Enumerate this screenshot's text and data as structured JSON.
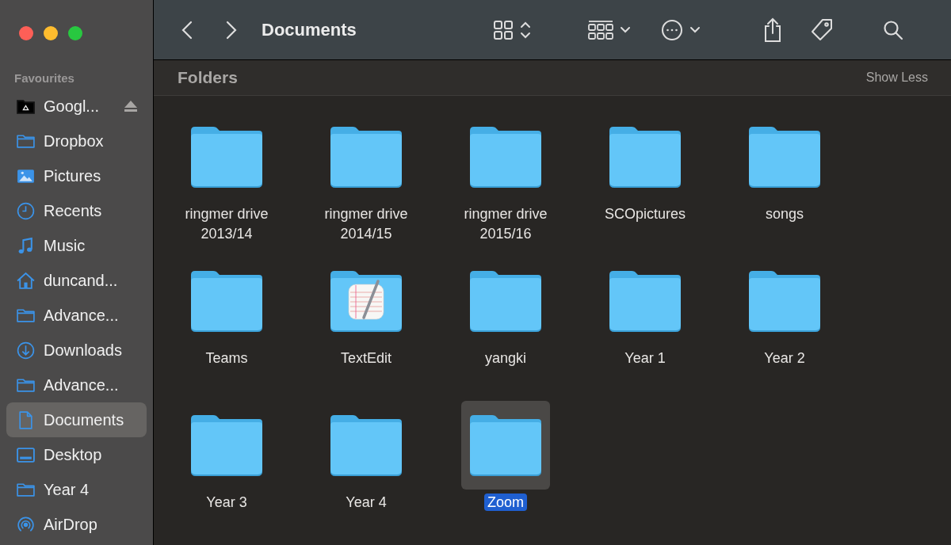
{
  "window": {
    "title": "Documents"
  },
  "sidebar": {
    "heading": "Favourites",
    "items": [
      {
        "label": "Googl...",
        "kind": "drive",
        "selected": false,
        "eject": true
      },
      {
        "label": "Dropbox",
        "kind": "folder",
        "selected": false,
        "eject": false
      },
      {
        "label": "Pictures",
        "kind": "photo",
        "selected": false,
        "eject": false
      },
      {
        "label": "Recents",
        "kind": "clock",
        "selected": false,
        "eject": false
      },
      {
        "label": "Music",
        "kind": "music",
        "selected": false,
        "eject": false
      },
      {
        "label": "duncand...",
        "kind": "home",
        "selected": false,
        "eject": false
      },
      {
        "label": "Advance...",
        "kind": "folder",
        "selected": false,
        "eject": false
      },
      {
        "label": "Downloads",
        "kind": "download",
        "selected": false,
        "eject": false
      },
      {
        "label": "Advance...",
        "kind": "folder",
        "selected": false,
        "eject": false
      },
      {
        "label": "Documents",
        "kind": "document",
        "selected": true,
        "eject": false
      },
      {
        "label": "Desktop",
        "kind": "desktop",
        "selected": false,
        "eject": false
      },
      {
        "label": "Year 4",
        "kind": "folder",
        "selected": false,
        "eject": false
      },
      {
        "label": "AirDrop",
        "kind": "airdrop",
        "selected": false,
        "eject": false
      }
    ]
  },
  "section": {
    "title": "Folders",
    "action": "Show Less"
  },
  "folders": [
    {
      "name": "ringmer drive 2013/14",
      "kind": "folder",
      "selected": false
    },
    {
      "name": "ringmer drive 2014/15",
      "kind": "folder",
      "selected": false
    },
    {
      "name": "ringmer drive 2015/16",
      "kind": "folder",
      "selected": false
    },
    {
      "name": "SCOpictures",
      "kind": "folder",
      "selected": false
    },
    {
      "name": "songs",
      "kind": "folder",
      "selected": false
    },
    {
      "name": "Teams",
      "kind": "folder",
      "selected": false
    },
    {
      "name": "TextEdit",
      "kind": "app-folder",
      "selected": false
    },
    {
      "name": "yangki",
      "kind": "folder",
      "selected": false
    },
    {
      "name": "Year 1",
      "kind": "folder",
      "selected": false
    },
    {
      "name": "Year 2",
      "kind": "folder",
      "selected": false
    },
    {
      "name": "Year 3",
      "kind": "folder",
      "selected": false
    },
    {
      "name": "Year 4",
      "kind": "folder",
      "selected": false
    },
    {
      "name": "Zoom",
      "kind": "folder",
      "selected": true
    }
  ]
}
